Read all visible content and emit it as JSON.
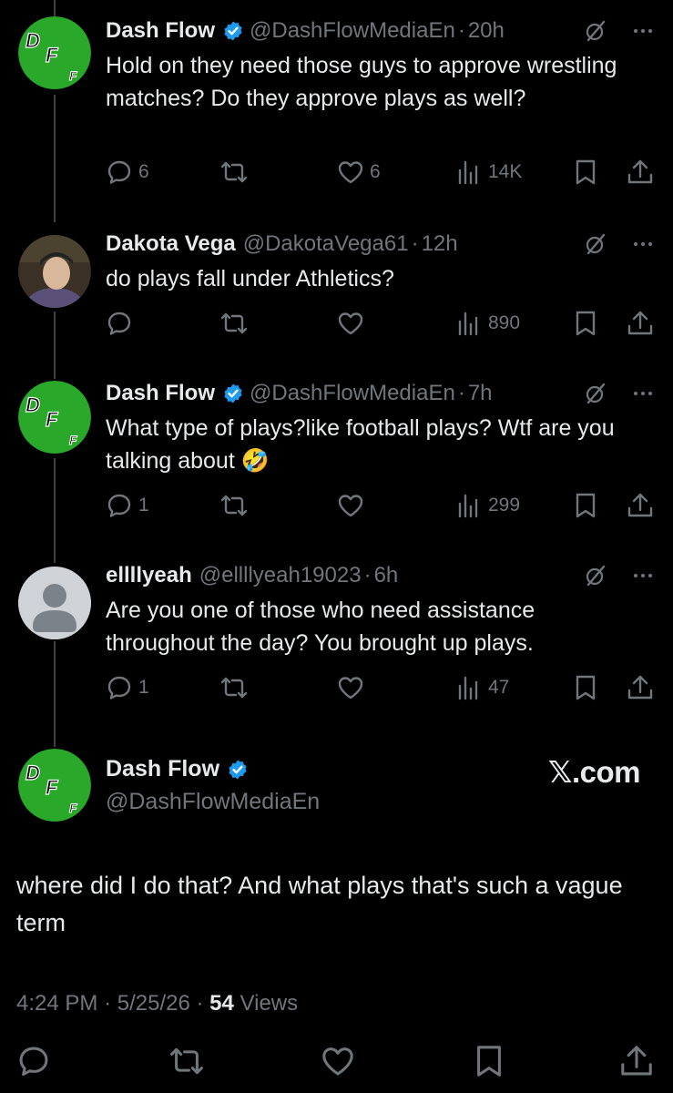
{
  "colors": {
    "background": "#000000",
    "text": "#e7e9ea",
    "muted": "#71767b",
    "verified": "#1d9bf0",
    "avatar_green": "#2aa82a"
  },
  "tweets": [
    {
      "name": "Dash Flow",
      "verified": true,
      "handle": "@DashFlowMediaEn",
      "time": "20h",
      "text": "Hold on they need those guys to approve wrestling matches? Do they approve plays as well?",
      "replies": "6",
      "retweets": "",
      "likes": "6",
      "views": "14K",
      "avatar": "df-logo"
    },
    {
      "name": "Dakota Vega",
      "verified": false,
      "handle": "@DakotaVega61",
      "time": "12h",
      "text": "do plays fall under Athletics?",
      "replies": "",
      "retweets": "",
      "likes": "",
      "views": "890",
      "avatar": "photo"
    },
    {
      "name": "Dash Flow",
      "verified": true,
      "handle": "@DashFlowMediaEn",
      "time": "7h",
      "text": "What type of plays?like football plays? Wtf are you talking about",
      "emoji": "🤣",
      "replies": "1",
      "retweets": "",
      "likes": "",
      "views": "299",
      "avatar": "df-logo"
    },
    {
      "name": "ellllyeah",
      "verified": false,
      "handle": "@ellllyeah19023",
      "time": "6h",
      "text": "Are you one of those who need assistance throughout the day? You brought up plays.",
      "replies": "1",
      "retweets": "",
      "likes": "",
      "views": "47",
      "avatar": "default"
    }
  ],
  "main_tweet": {
    "name": "Dash Flow",
    "handle": "@DashFlowMediaEn",
    "watermark": "𝕏.com",
    "text": "where did I do that? And what plays that's such a vague term",
    "time": "4:24 PM",
    "date": "5/25/26",
    "views_count": "54",
    "views_label": "Views"
  },
  "separator": "·"
}
